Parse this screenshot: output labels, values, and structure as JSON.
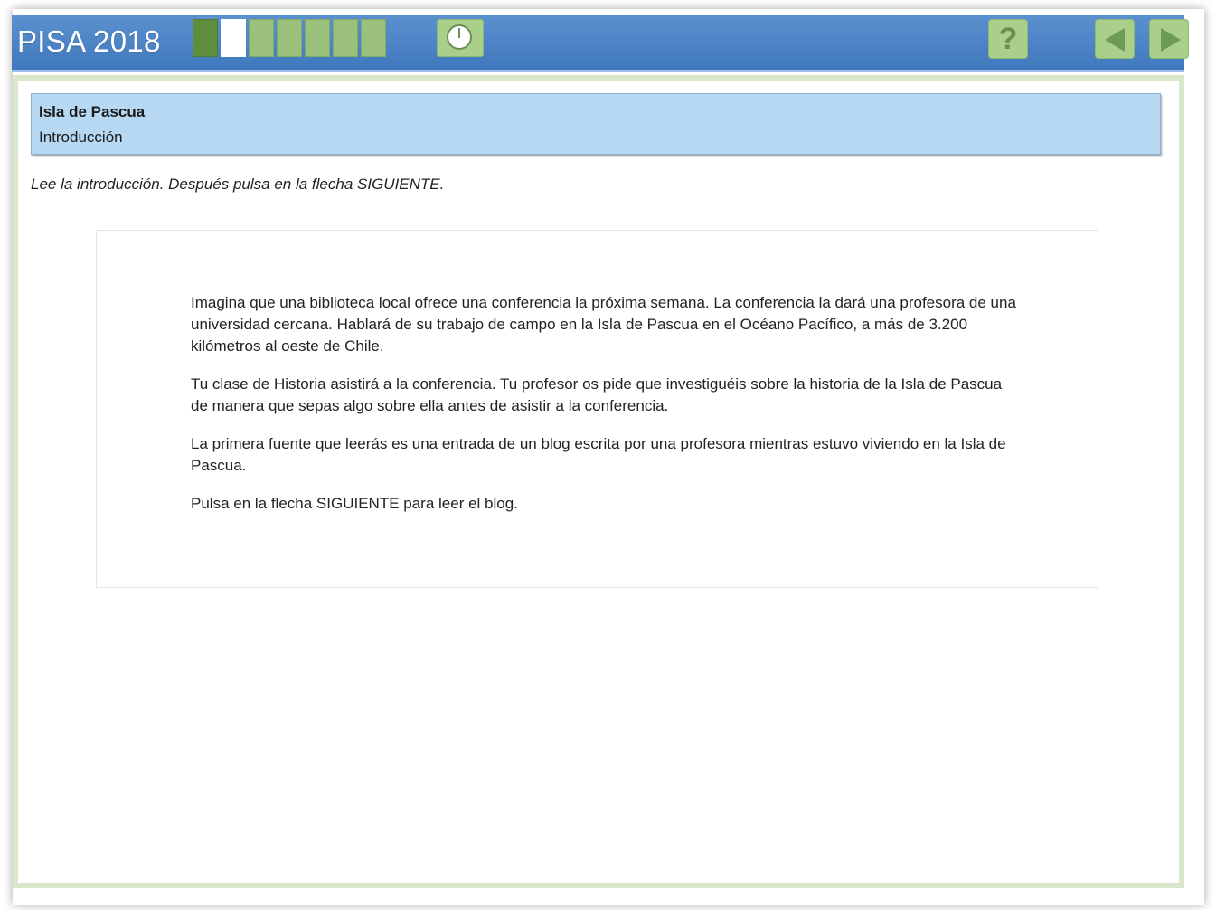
{
  "header": {
    "app_title": "PISA 2018",
    "progress": {
      "total_segments": 7,
      "current_segment": 2
    },
    "timer_icon": "clock-icon",
    "help_label": "?",
    "prev_icon": "triangle-left-icon",
    "next_icon": "triangle-right-icon"
  },
  "unit": {
    "title": "Isla de Pascua",
    "subtitle": "Introducción"
  },
  "instruction": "Lee la introducción. Después pulsa en la flecha SIGUIENTE.",
  "passage": {
    "paragraphs": [
      "Imagina que una biblioteca local ofrece una conferencia la próxima semana. La conferencia la dará una profesora de una universidad cercana. Hablará de su trabajo de campo en la Isla de Pascua en el Océano Pacífico, a más de 3.200 kilómetros al oeste de Chile.",
      "Tu clase de Historia asistirá a la conferencia. Tu profesor os pide que investiguéis sobre la historia de la Isla de Pascua de manera que sepas algo sobre ella antes de asistir a la conferencia.",
      "La primera fuente que leerás es una entrada de un blog escrita por una profesora mientras estuvo viviendo en la Isla de Pascua.",
      "Pulsa en la flecha SIGUIENTE para leer el blog."
    ]
  },
  "colors": {
    "header_bar": "#4a83c6",
    "accent_green": "#a9cf8b",
    "progress_done": "#5f8d3f",
    "unit_box": "#b6d8f3",
    "frame_green": "#d9e8cd"
  }
}
